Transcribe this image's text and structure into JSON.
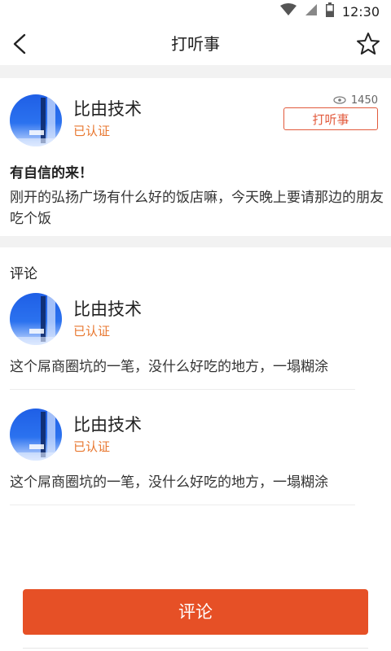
{
  "status_bar": {
    "time": "12:30",
    "icons": [
      "wifi-icon",
      "signal-icon",
      "battery-icon"
    ]
  },
  "nav": {
    "title": "打听事",
    "back_icon": "chevron-left-icon",
    "favorite_icon": "star-outline-icon"
  },
  "post": {
    "author": {
      "name": "比由技术",
      "badge": "已认证"
    },
    "views": "1450",
    "inquire_button": "打听事",
    "title": "有自信的来！",
    "body": "刚开的弘扬广场有什么好的饭店嘛，今天晚上要请那边的朋友吃个饭"
  },
  "comments": {
    "heading": "评论",
    "items": [
      {
        "name": "比由技术",
        "badge": "已认证",
        "text": "这个屌商圈坑的一笔，没什么好吃的地方，一塌糊涂"
      },
      {
        "name": "比由技术",
        "badge": "已认证",
        "text": "这个屌商圈坑的一笔，没什么好吃的地方，一塌糊涂"
      }
    ]
  },
  "footer": {
    "comment_button": "评论"
  },
  "colors": {
    "accent": "#e65026",
    "badge": "#e8772f",
    "separator": "#f2f2f2"
  }
}
